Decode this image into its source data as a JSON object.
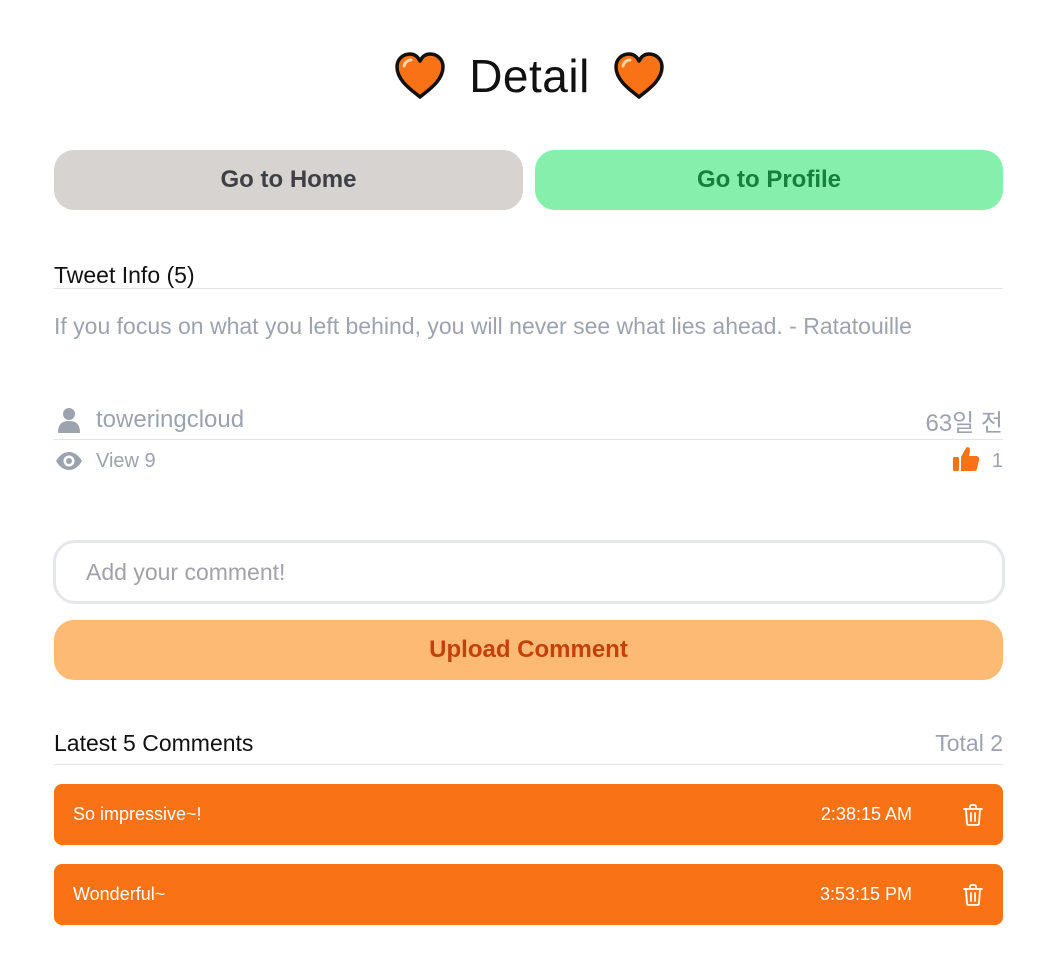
{
  "header": {
    "title": "Detail",
    "left_icon": "orange-heart-icon",
    "right_icon": "orange-heart-icon"
  },
  "nav": {
    "home_label": "Go to Home",
    "profile_label": "Go to Profile"
  },
  "tweet": {
    "section_title": "Tweet Info (5)",
    "text": "If you focus on what you left behind, you will never see what lies ahead. - Ratatouille",
    "username": "toweringcloud",
    "date": "63일 전",
    "views": "View 9",
    "likes": "1"
  },
  "comment_form": {
    "placeholder": "Add your comment!",
    "submit_label": "Upload Comment"
  },
  "comments": {
    "title": "Latest 5 Comments",
    "total": "Total 2",
    "items": [
      {
        "text": "So impressive~!",
        "time": "2:38:15 AM"
      },
      {
        "text": "Wonderful~",
        "time": "3:53:15 PM"
      }
    ]
  },
  "colors": {
    "accent": "#f97316",
    "heart": "#f97316",
    "home_button": "#d7d3d0",
    "profile_button": "#86efac",
    "upload_button": "#fdba74",
    "upload_text": "#c2410c",
    "muted_text": "#9ca3af"
  }
}
